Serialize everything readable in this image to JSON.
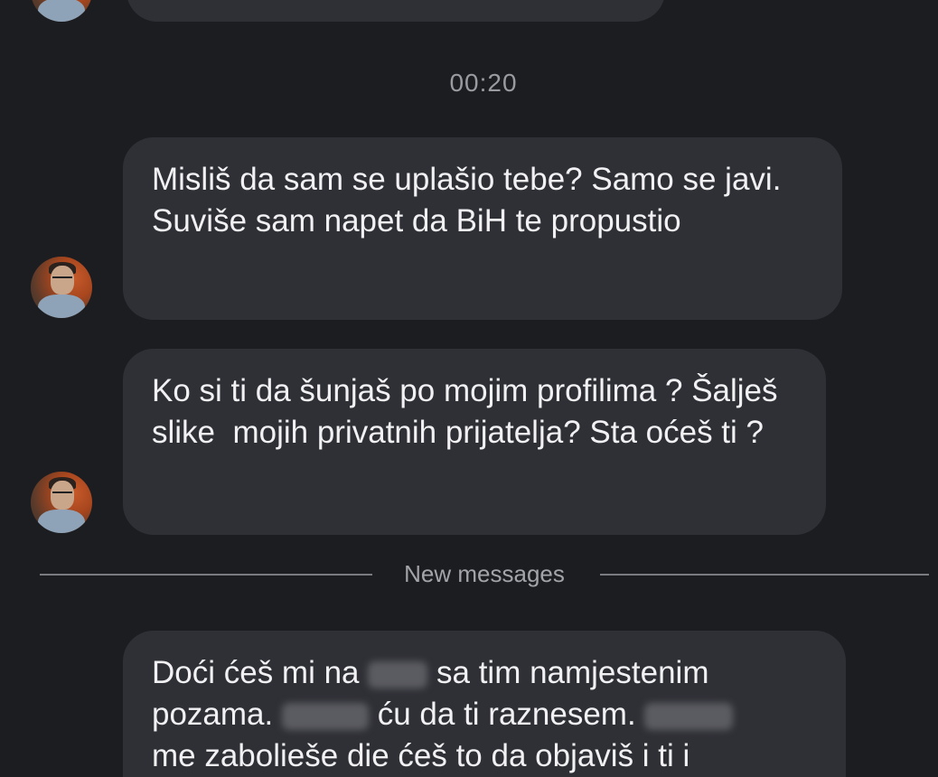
{
  "timestamp": "00:20",
  "messages": [
    {
      "text": "Misliš da sam se uplašio tebe? Samo se javi. Suviše sam napet da BiH te propustio"
    },
    {
      "text": "Ko si ti da šunjaš po mojim profilima ? Šalješ slike  mojih privatnih prijatelja? Sta oćeš ti ?"
    }
  ],
  "divider": {
    "label": "New messages"
  },
  "new_message": {
    "line1_a": "Doći ćeš mi na",
    "line1_b": "sa tim namjestenim",
    "line2_a": "pozama.",
    "line2_b": "ću da ti raznesem.",
    "line3": "me zabolieše die ćeš to da objaviš i ti i"
  }
}
